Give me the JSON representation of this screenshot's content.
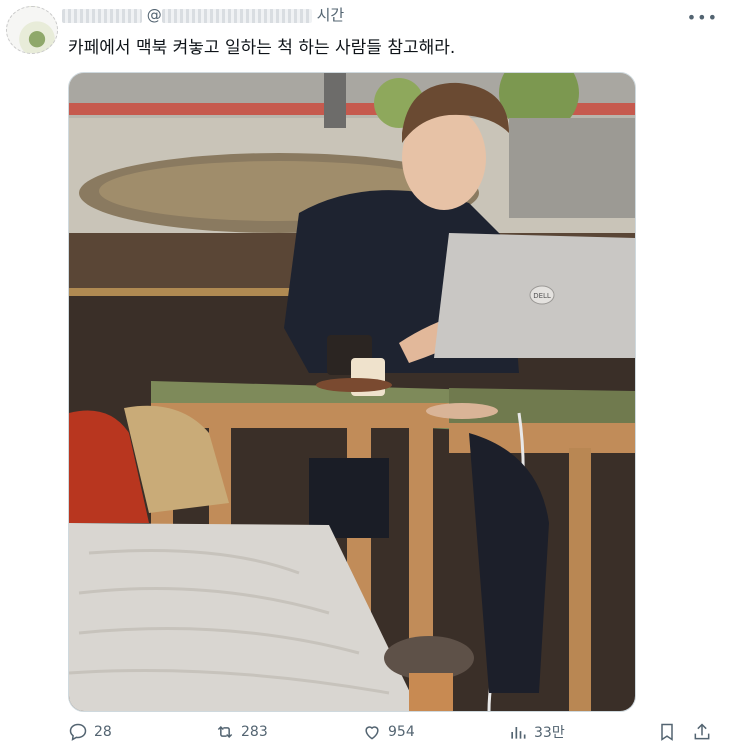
{
  "tweet": {
    "author_handle_prefix": "@",
    "time": "시간",
    "text": "카페에서 맥북 켜놓고 일하는 척 하는 사람들 참고해라.",
    "image_alt": "Man working on a laptop at a cafe table",
    "laptop_logo": "DELL"
  },
  "actions": {
    "replies": "28",
    "retweets": "283",
    "likes": "954",
    "views": "33만"
  },
  "icons": {
    "more": "more-icon",
    "reply": "reply-icon",
    "retweet": "retweet-icon",
    "like": "heart-icon",
    "views": "views-icon",
    "bookmark": "bookmark-icon",
    "share": "share-icon"
  }
}
